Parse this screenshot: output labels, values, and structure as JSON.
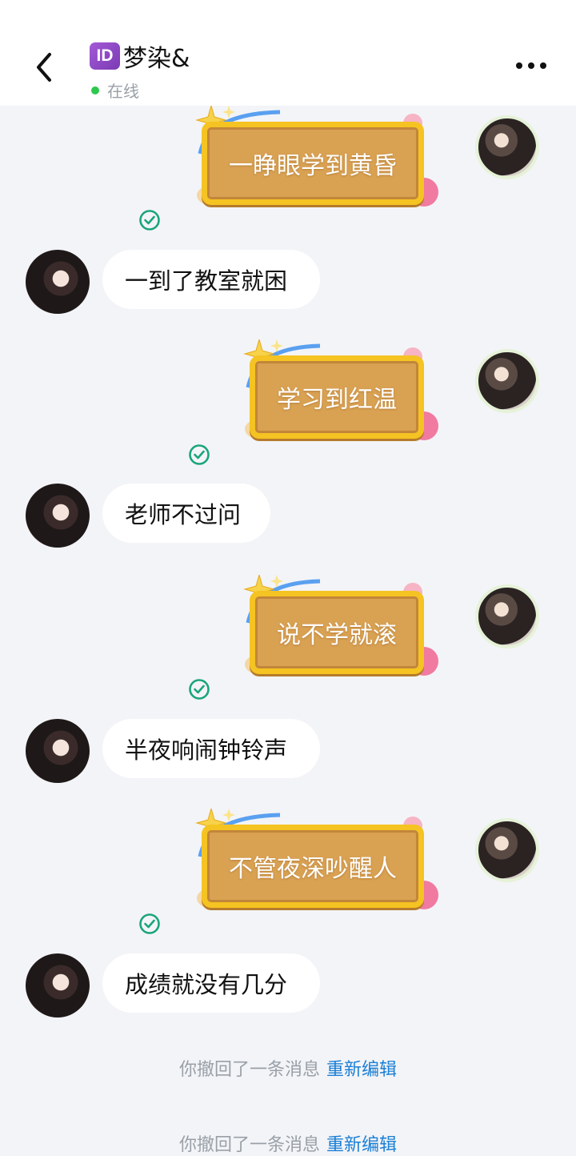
{
  "header": {
    "badge": "ID",
    "name": "梦染&",
    "status": "在线"
  },
  "messages": [
    {
      "dir": "out",
      "text": "一睁眼学到黄昏"
    },
    {
      "dir": "in",
      "text": "一到了教室就困"
    },
    {
      "dir": "out",
      "text": "学习到红温"
    },
    {
      "dir": "in",
      "text": "老师不过问"
    },
    {
      "dir": "out",
      "text": "说不学就滚"
    },
    {
      "dir": "in",
      "text": "半夜响闹钟铃声"
    },
    {
      "dir": "out",
      "text": "不管夜深吵醒人"
    },
    {
      "dir": "in",
      "text": "成绩就没有几分"
    }
  ],
  "recall": {
    "text": "你撤回了一条消息",
    "edit": "重新编辑"
  },
  "colors": {
    "bubble_fill": "#d9a152",
    "bubble_border": "#f5c322",
    "read_check": "#1aa57a",
    "link": "#1b7fd6",
    "online": "#2ec84e"
  }
}
